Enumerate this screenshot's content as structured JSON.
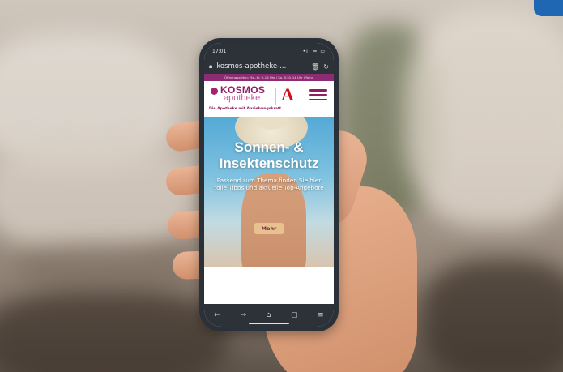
{
  "status_bar": {
    "time": "17:01",
    "icons": "•ıl ≈ ▭"
  },
  "browser": {
    "url": "kosmos-apotheke-...",
    "lock_icon": "lock-icon",
    "actions": [
      "trash-icon",
      "refresh-icon"
    ]
  },
  "topbar": {
    "hours": "Öffnungszeiten: Mo.–Fr. 9–19 Uhr | Sa. 8:30–14 Uhr | Rand"
  },
  "header": {
    "logo_top": "KOSMOS",
    "logo_bottom": "apotheke",
    "tagline": "Die Apotheke mit Anziehungskraft",
    "apo_symbol": "A"
  },
  "hero": {
    "title_line1": "Sonnen- &",
    "title_line2": "Insektenschutz",
    "subtitle": "Passend zum Thema finden Sie hier tolle Tipps und aktuelle Top-Angebote",
    "cta": "Mehr"
  },
  "nav": {
    "back": "←",
    "forward": "→",
    "home": "⌂",
    "tabs": "▢",
    "menu": "≡"
  },
  "colors": {
    "brand": "#8e1f62",
    "brand_light": "#bf5ea1",
    "cta": "#e7c28e",
    "apo_red": "#d10d1b",
    "browser_chrome": "#2c3237"
  }
}
